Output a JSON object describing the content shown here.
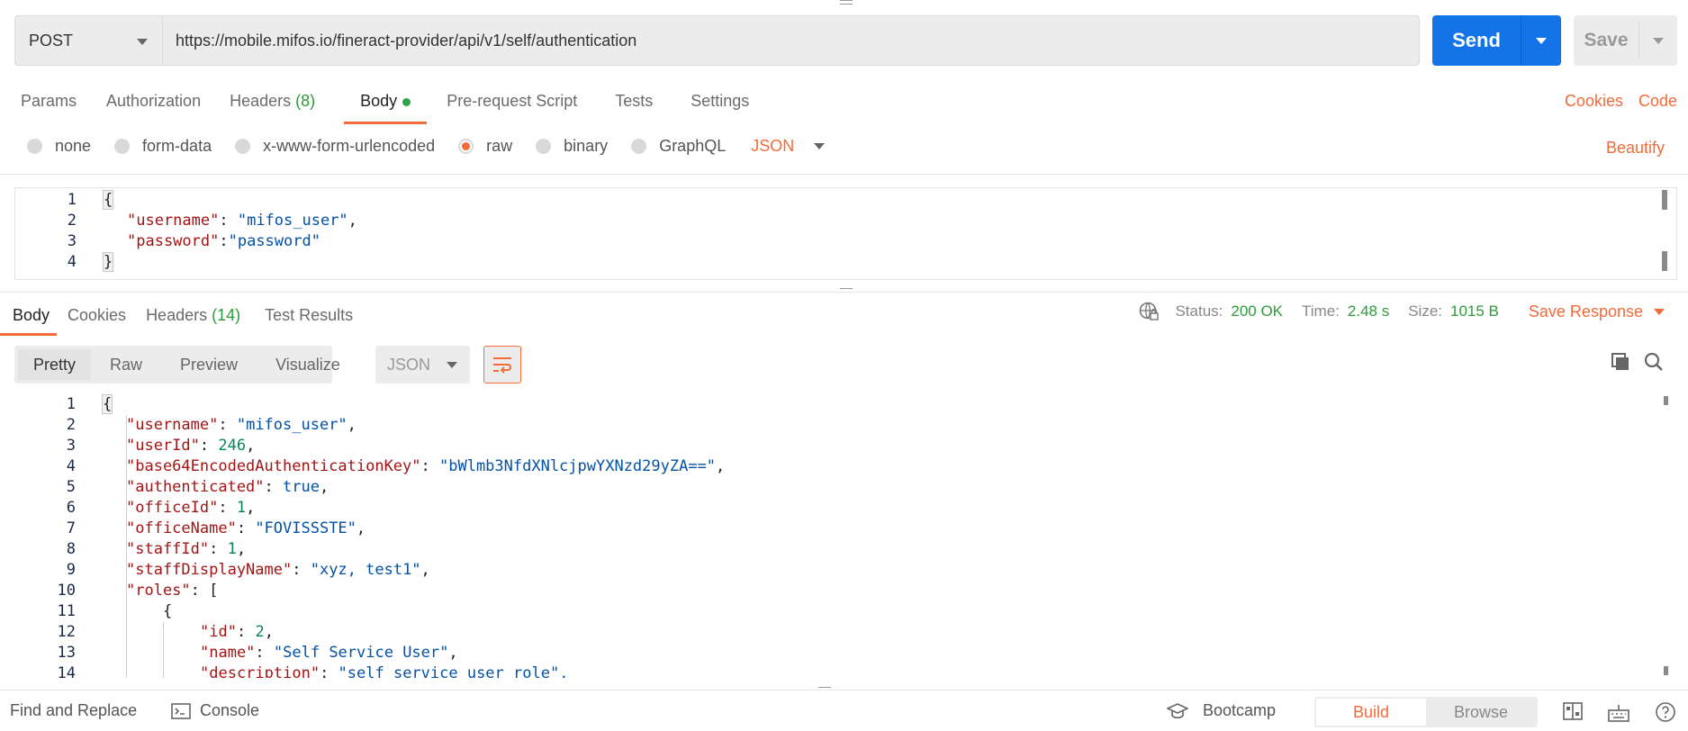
{
  "request": {
    "method": "POST",
    "url": "https://mobile.mifos.io/fineract-provider/api/v1/self/authentication",
    "send_label": "Send",
    "save_label": "Save"
  },
  "request_tabs": [
    {
      "label": "Params"
    },
    {
      "label": "Authorization"
    },
    {
      "label": "Headers",
      "count": "(8)"
    },
    {
      "label": "Body",
      "active": true
    },
    {
      "label": "Pre-request Script"
    },
    {
      "label": "Tests"
    },
    {
      "label": "Settings"
    }
  ],
  "right_links": {
    "cookies": "Cookies",
    "code": "Code"
  },
  "body_types": {
    "none": "none",
    "form_data": "form-data",
    "urlencoded": "x-www-form-urlencoded",
    "raw": "raw",
    "binary": "binary",
    "graphql": "GraphQL",
    "selected": "raw",
    "format": "JSON"
  },
  "beautify": "Beautify",
  "request_body": {
    "line_numbers": [
      "1",
      "2",
      "3",
      "4"
    ],
    "open": "{",
    "close": "}",
    "username_key": "\"username\"",
    "username_val": "\"mifos_user\"",
    "password_key": "\"password\"",
    "password_val": "\"password\""
  },
  "response_tabs": {
    "body": "Body",
    "cookies": "Cookies",
    "headers": "Headers",
    "headers_count": "(14)",
    "test_results": "Test Results"
  },
  "response_status": {
    "status_label": "Status:",
    "status_value": "200 OK",
    "time_label": "Time:",
    "time_value": "2.48 s",
    "size_label": "Size:",
    "size_value": "1015 B",
    "save_response": "Save Response"
  },
  "view_tabs": {
    "pretty": "Pretty",
    "raw": "Raw",
    "preview": "Preview",
    "visualize": "Visualize",
    "format": "JSON"
  },
  "response_body": {
    "line_numbers": [
      "1",
      "2",
      "3",
      "4",
      "5",
      "6",
      "7",
      "8",
      "9",
      "10",
      "11",
      "12",
      "13",
      "14"
    ],
    "open": "{",
    "k_username": "\"username\"",
    "v_username": "\"mifos_user\"",
    "k_userId": "\"userId\"",
    "v_userId": "246",
    "k_key": "\"base64EncodedAuthenticationKey\"",
    "v_key": "\"bWlmb3NfdXNlcjpwYXNzd29yZA==\"",
    "k_auth": "\"authenticated\"",
    "v_auth": "true",
    "k_officeId": "\"officeId\"",
    "v_officeId": "1",
    "k_officeName": "\"officeName\"",
    "v_officeName": "\"FOVISSSTE\"",
    "k_staffId": "\"staffId\"",
    "v_staffId": "1",
    "k_staffDisplayName": "\"staffDisplayName\"",
    "v_staffDisplayName": "\"xyz, test1\"",
    "k_roles": "\"roles\"",
    "roles_open": "[",
    "obj_open": "{",
    "k_id": "\"id\"",
    "v_id": "2",
    "k_name": "\"name\"",
    "v_name": "\"Self Service User\"",
    "k_desc": "\"description\"",
    "v_desc": "\"self service user role\","
  },
  "footer": {
    "find_replace": "Find and Replace",
    "console": "Console",
    "bootcamp": "Bootcamp",
    "build": "Build",
    "browse": "Browse"
  },
  "colors": {
    "accent": "#f26b3a",
    "send": "#1473e6",
    "success": "#2e9b3a"
  }
}
